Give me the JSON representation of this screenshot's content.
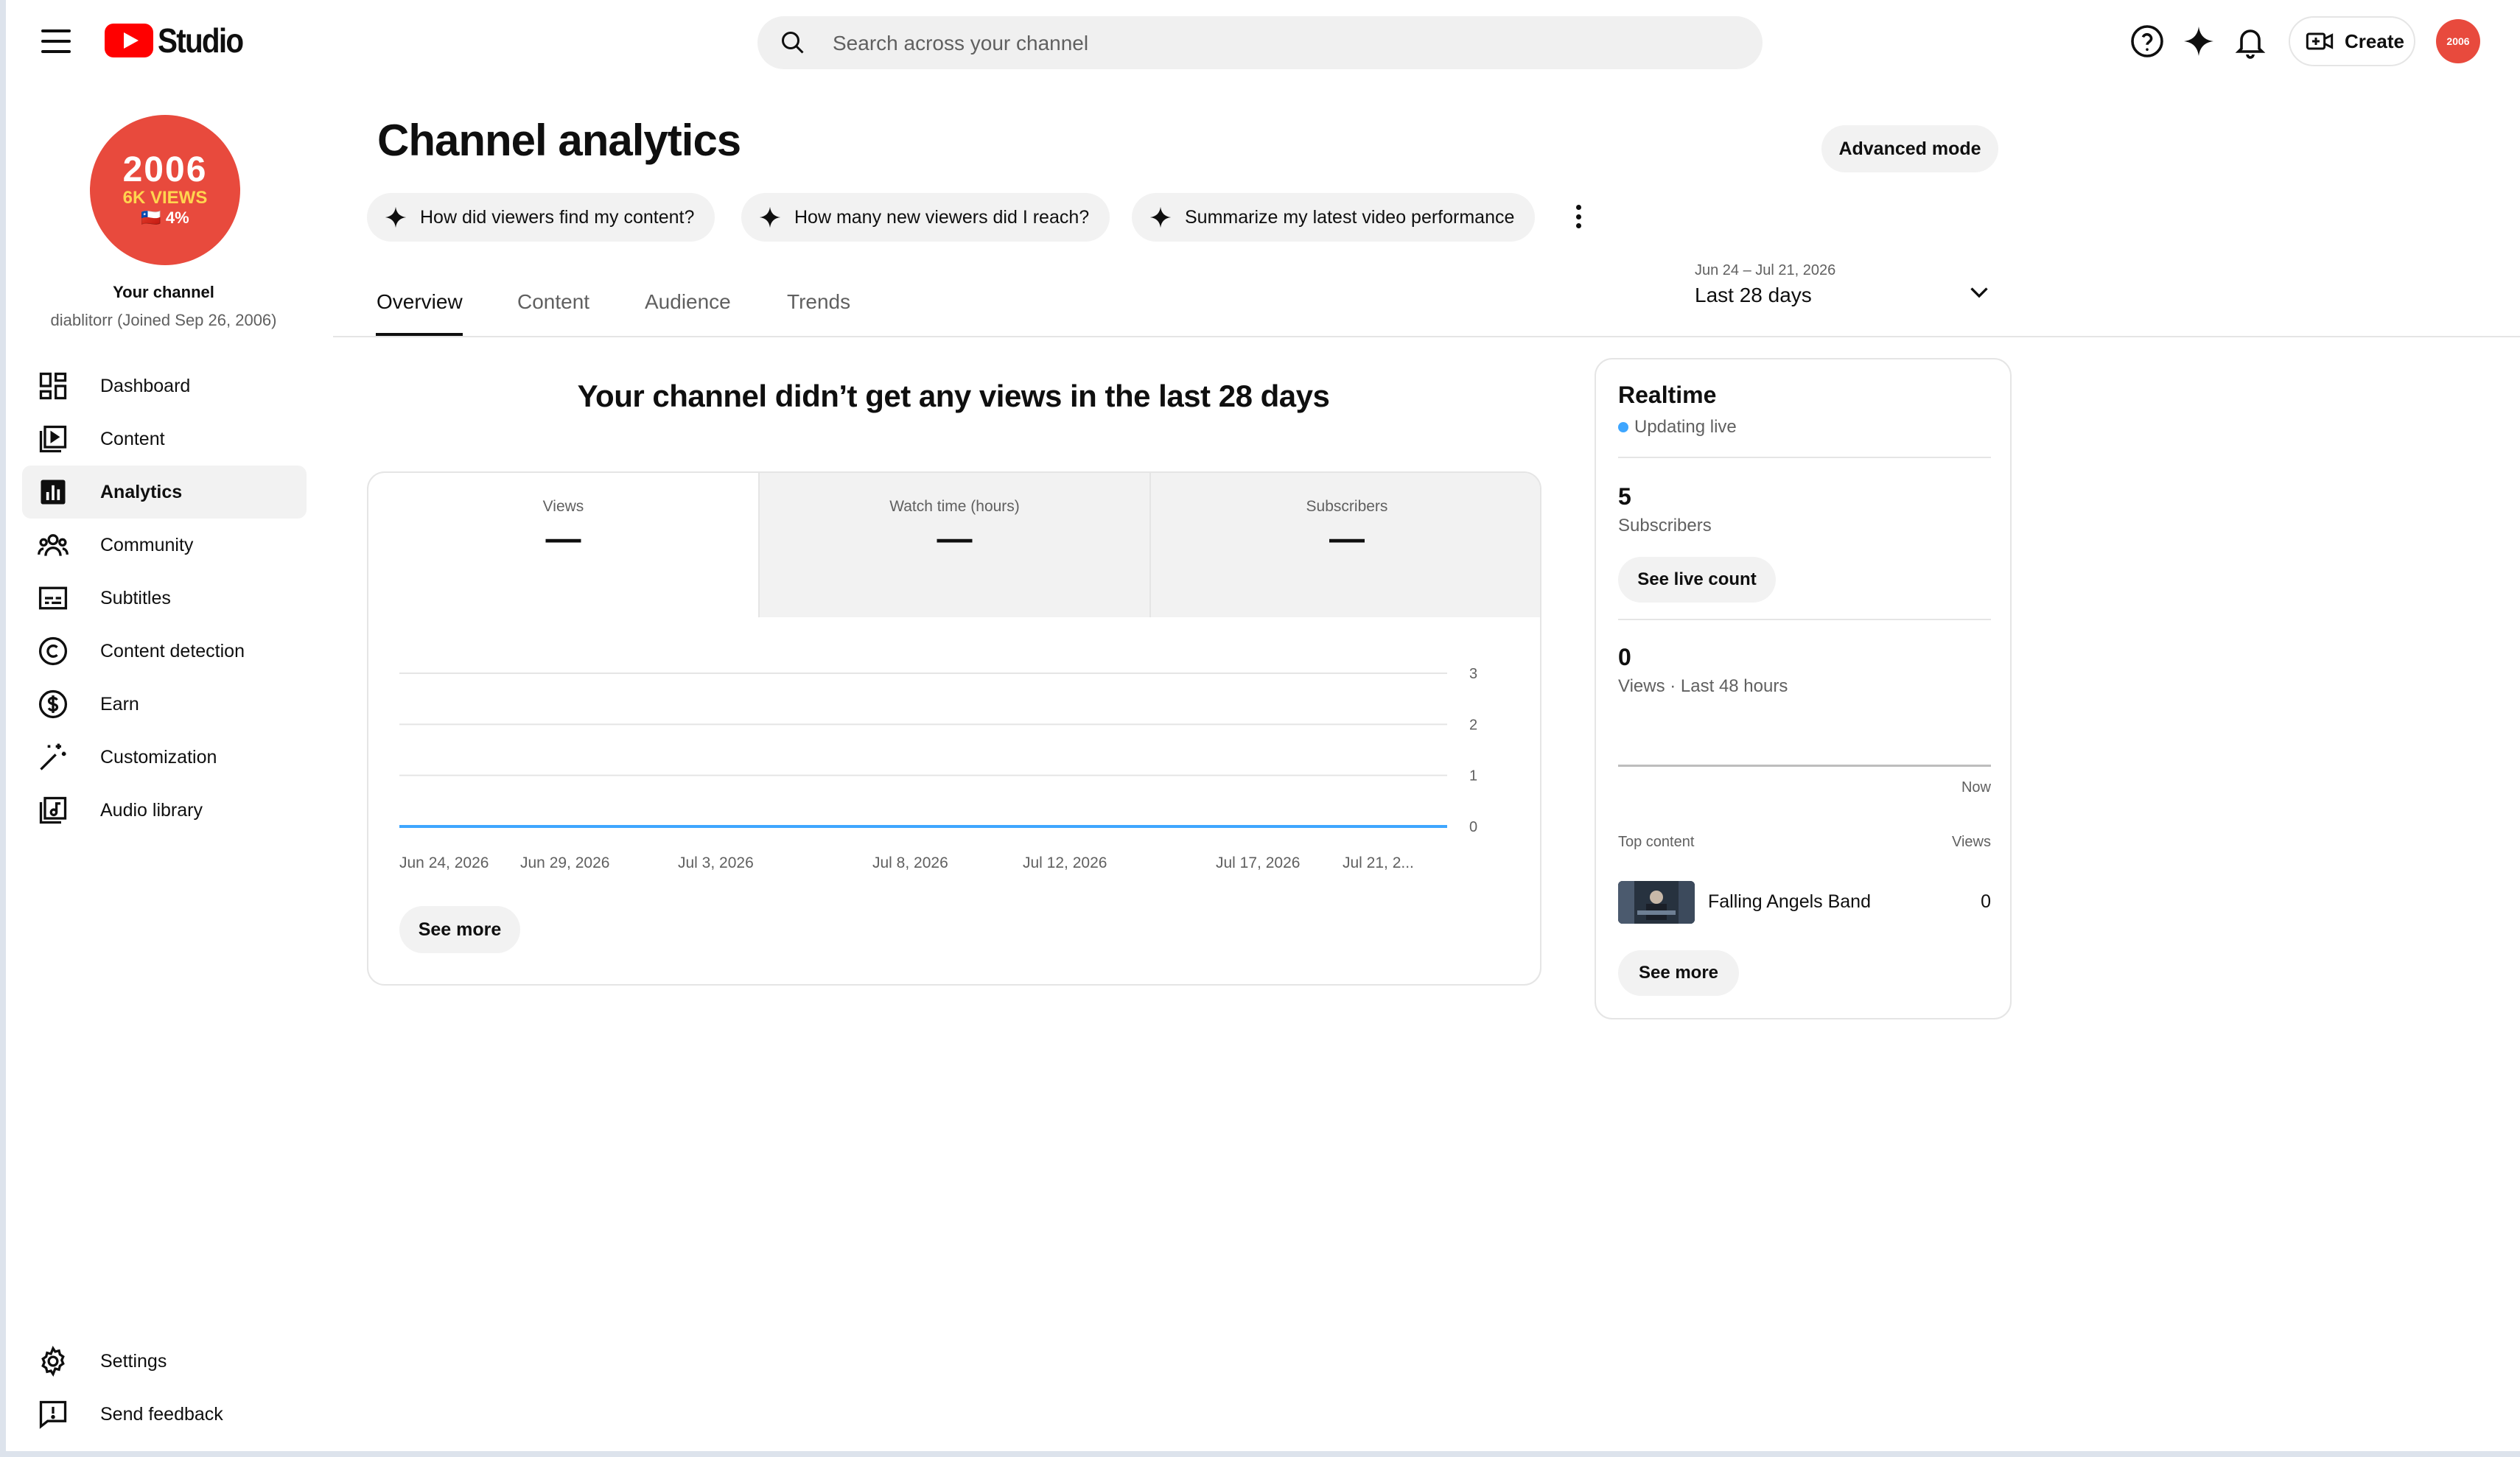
{
  "app": {
    "logo_text": "Studio"
  },
  "search": {
    "placeholder": "Search across your channel"
  },
  "topbar": {
    "create_label": "Create",
    "avatar_text": "2006"
  },
  "channel": {
    "avatar_year": "2006",
    "avatar_views": "6K VIEWS",
    "avatar_pct": "🇨🇱 4%",
    "label": "Your channel",
    "handle_info": "diablitorr (Joined Sep 26, 2006)"
  },
  "sidebar": {
    "items": [
      {
        "label": "Dashboard",
        "icon": "dashboard-icon"
      },
      {
        "label": "Content",
        "icon": "content-icon"
      },
      {
        "label": "Analytics",
        "icon": "analytics-icon",
        "active": true
      },
      {
        "label": "Community",
        "icon": "community-icon"
      },
      {
        "label": "Subtitles",
        "icon": "subtitles-icon"
      },
      {
        "label": "Content detection",
        "icon": "copyright-icon"
      },
      {
        "label": "Earn",
        "icon": "dollar-icon"
      },
      {
        "label": "Customization",
        "icon": "magic-wand-icon"
      },
      {
        "label": "Audio library",
        "icon": "audio-library-icon"
      }
    ],
    "bottom": [
      {
        "label": "Settings",
        "icon": "gear-icon"
      },
      {
        "label": "Send feedback",
        "icon": "feedback-icon"
      }
    ]
  },
  "main": {
    "title": "Channel analytics",
    "advanced_mode": "Advanced mode",
    "chips": [
      "How did viewers find my content?",
      "How many new viewers did I reach?",
      "Summarize my latest video performance"
    ],
    "tabs": [
      "Overview",
      "Content",
      "Audience",
      "Trends"
    ],
    "active_tab": "Overview",
    "date_range": {
      "dates": "Jun 24 – Jul 21, 2026",
      "label": "Last 28 days"
    },
    "no_views_message": "Your channel didn’t get any views in the last 28 days",
    "metrics": [
      {
        "label": "Views",
        "value": "—"
      },
      {
        "label": "Watch time (hours)",
        "value": "—"
      },
      {
        "label": "Subscribers",
        "value": "—"
      }
    ],
    "see_more": "See more"
  },
  "chart_data": {
    "type": "line",
    "x": [
      "Jun 24, 2026",
      "Jun 29, 2026",
      "Jul 3, 2026",
      "Jul 8, 2026",
      "Jul 12, 2026",
      "Jul 17, 2026",
      "Jul 21, 2..."
    ],
    "series": [
      {
        "values": [
          0,
          0,
          0,
          0,
          0,
          0,
          0
        ]
      }
    ],
    "yticks": [
      "3",
      "2",
      "1",
      "0"
    ],
    "ylim": [
      0,
      3
    ],
    "grid": true,
    "line_color": "#3ea6ff"
  },
  "realtime": {
    "title": "Realtime",
    "status": "Updating live",
    "subscribers_value": "5",
    "subscribers_label": "Subscribers",
    "see_live_count": "See live count",
    "views_value": "0",
    "views_label": "Views · Last 48 hours",
    "now_label": "Now",
    "top_content_label": "Top content",
    "views_col_label": "Views",
    "top_item_title": "Falling Angels Band",
    "top_item_views": "0",
    "see_more": "See more"
  }
}
